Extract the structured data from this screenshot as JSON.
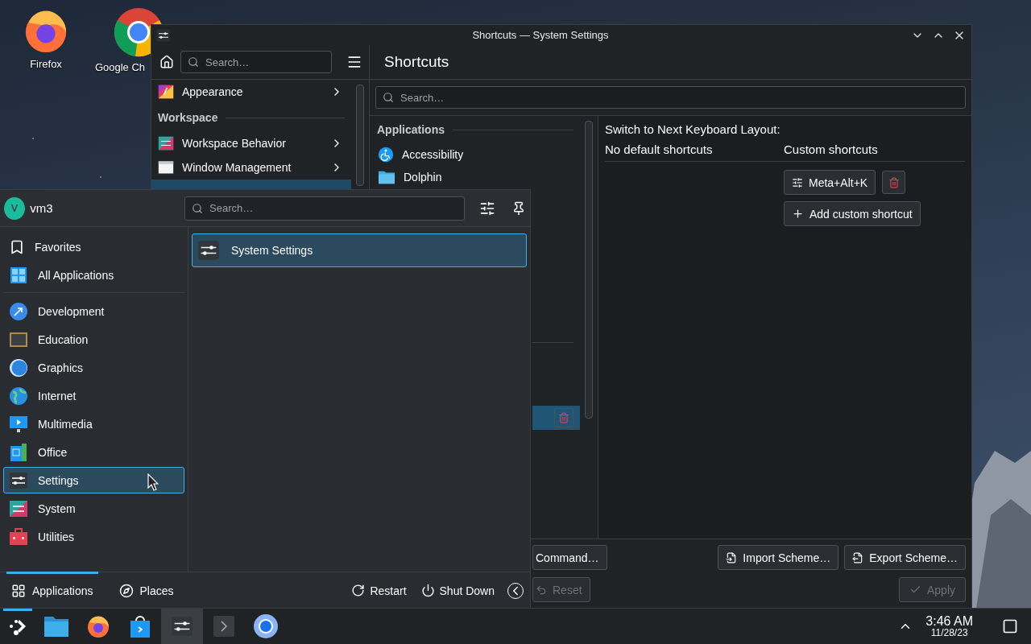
{
  "desktop_icons": [
    {
      "label": "Firefox"
    },
    {
      "label": "Google Ch"
    }
  ],
  "settings": {
    "title": "Shortcuts — System Settings",
    "sidebar_search": {
      "placeholder": "Search…"
    },
    "sidebar": [
      {
        "kind": "item",
        "label": "Appearance",
        "selected": false
      },
      {
        "kind": "section",
        "label": "Workspace"
      },
      {
        "kind": "item",
        "label": "Workspace Behavior",
        "selected": false
      },
      {
        "kind": "item",
        "label": "Window Management",
        "selected": false
      },
      {
        "kind": "item",
        "selected": true
      }
    ],
    "page_title": "Shortcuts",
    "search": {
      "placeholder": "Search…"
    },
    "list": [
      {
        "kind": "section",
        "label": "Applications"
      },
      {
        "kind": "item",
        "label": "Accessibility",
        "selected": false
      },
      {
        "kind": "item",
        "label": "Dolphin",
        "selected": false
      },
      {
        "kind": "divider"
      },
      {
        "kind": "item",
        "selected": true
      }
    ],
    "detail": {
      "action": "Switch to Next Keyboard Layout:",
      "default_header": "No default shortcuts",
      "custom_header": "Custom shortcuts",
      "shortcuts": [
        "Meta+Alt+K"
      ],
      "add_label": "Add custom shortcut"
    },
    "footer": [
      {
        "left": [
          {
            "label": "Command…",
            "disabled": false
          }
        ],
        "right": [
          {
            "label": "Import Scheme…",
            "disabled": false
          },
          {
            "label": "Export Scheme…",
            "disabled": false
          }
        ]
      },
      {
        "left": [
          {
            "label": "Reset",
            "disabled": true
          }
        ],
        "right": [
          {
            "label": "Apply",
            "disabled": true
          }
        ]
      }
    ]
  },
  "launcher": {
    "user": {
      "initial": "V",
      "name": "vm3"
    },
    "search": {
      "placeholder": "Search…"
    },
    "categories": [
      {
        "kind": "item",
        "label": "Favorites",
        "selected": false
      },
      {
        "kind": "item",
        "label": "All Applications",
        "selected": false
      },
      {
        "kind": "divider"
      },
      {
        "kind": "item",
        "label": "Development",
        "selected": false
      },
      {
        "kind": "item",
        "label": "Education",
        "selected": false
      },
      {
        "kind": "item",
        "label": "Graphics",
        "selected": false
      },
      {
        "kind": "item",
        "label": "Internet",
        "selected": false
      },
      {
        "kind": "item",
        "label": "Multimedia",
        "selected": false
      },
      {
        "kind": "item",
        "label": "Office",
        "selected": false
      },
      {
        "kind": "item",
        "label": "Settings",
        "selected": true
      },
      {
        "kind": "item",
        "label": "System",
        "selected": false
      },
      {
        "kind": "item",
        "label": "Utilities",
        "selected": false
      }
    ],
    "results": [
      {
        "label": "System Settings",
        "selected": true
      }
    ],
    "tabs": [
      {
        "label": "Applications",
        "selected": true
      },
      {
        "label": "Places",
        "selected": false
      }
    ],
    "actions": [
      "Restart",
      "Shut Down"
    ]
  },
  "taskbar": {
    "items": [
      {
        "kind": "launcher",
        "open": true,
        "active": false
      },
      {
        "kind": "files",
        "open": false,
        "active": false
      },
      {
        "kind": "firefox",
        "open": false,
        "active": false
      },
      {
        "kind": "store",
        "open": false,
        "active": false
      },
      {
        "kind": "settings",
        "open": false,
        "active": true
      },
      {
        "kind": "terminal",
        "open": false,
        "active": false
      },
      {
        "kind": "chromium",
        "open": false,
        "active": false
      }
    ],
    "clock": {
      "time": "3:46 AM",
      "date": "11/28/23"
    }
  }
}
